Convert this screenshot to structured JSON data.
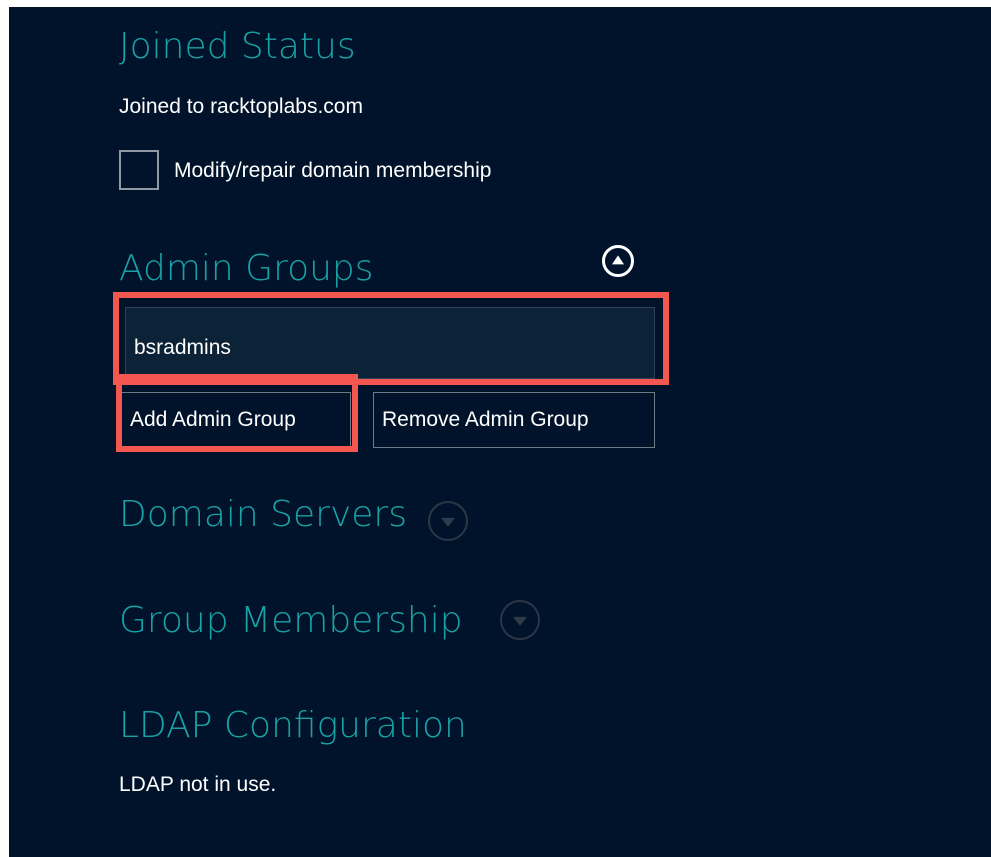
{
  "joined_status": {
    "title": "Joined Status",
    "status_text": "Joined to racktoplabs.com",
    "modify_checkbox": {
      "label": "Modify/repair domain membership",
      "checked": false
    }
  },
  "admin_groups": {
    "title": "Admin Groups",
    "expanded": true,
    "groups": [
      "bsradmins"
    ],
    "add_button_label": "Add Admin Group",
    "remove_button_label": "Remove Admin Group"
  },
  "domain_servers": {
    "title": "Domain Servers",
    "expanded": false
  },
  "group_membership": {
    "title": "Group Membership",
    "expanded": false
  },
  "ldap_configuration": {
    "title": "LDAP Configuration",
    "status_text": "LDAP not in use."
  },
  "colors": {
    "background": "#01132a",
    "heading": "#1aa1a6",
    "text": "#ffffff",
    "highlight": "#f4574f"
  },
  "icons": {
    "collapse": "chevron-up-circle-icon",
    "expand": "chevron-down-circle-icon"
  }
}
